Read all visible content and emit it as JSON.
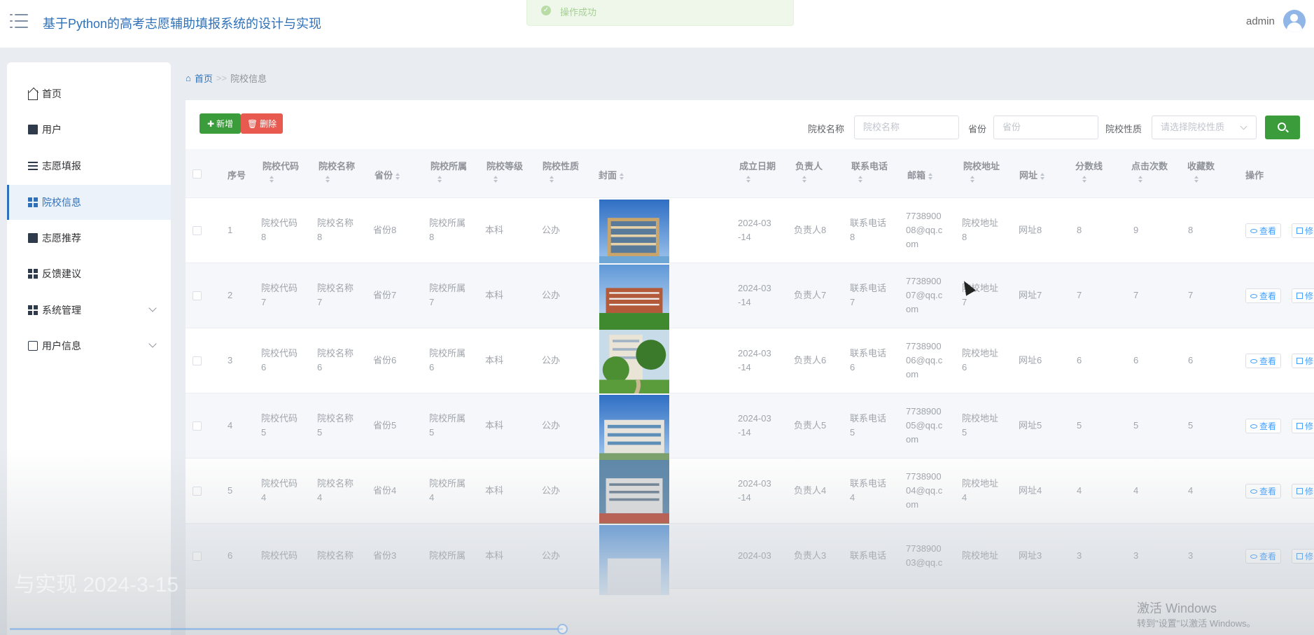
{
  "app": {
    "title": "基于Python的高考志愿辅助填报系统的设计与实现",
    "user": "admin"
  },
  "toast": {
    "text": "操作成功"
  },
  "sidebar": {
    "items": [
      {
        "label": "首页",
        "icon": "home-icon"
      },
      {
        "label": "用户",
        "icon": "book-icon"
      },
      {
        "label": "志愿填报",
        "icon": "list-icon"
      },
      {
        "label": "院校信息",
        "icon": "grid-icon",
        "active": true
      },
      {
        "label": "志愿推荐",
        "icon": "monitor-icon"
      },
      {
        "label": "反馈建议",
        "icon": "grid-icon"
      },
      {
        "label": "系统管理",
        "icon": "grid-icon",
        "expandable": true
      },
      {
        "label": "用户信息",
        "icon": "card-icon",
        "expandable": true
      }
    ]
  },
  "breadcrumb": {
    "home": "首页",
    "sep": ">>",
    "current": "院校信息"
  },
  "toolbar": {
    "add": "新增",
    "delete": "删除"
  },
  "filters": {
    "name_label": "院校名称",
    "name_placeholder": "院校名称",
    "province_label": "省份",
    "province_placeholder": "省份",
    "type_label": "院校性质",
    "type_placeholder": "请选择院校性质"
  },
  "table": {
    "headers": {
      "index": "序号",
      "code": "院校代码",
      "name": "院校名称",
      "province": "省份",
      "affiliation": "院校所属",
      "level": "院校等级",
      "nature": "院校性质",
      "cover": "封面",
      "founded": "成立日期",
      "leader": "负责人",
      "phone": "联系电话",
      "email": "邮箱",
      "address": "院校地址",
      "website": "网址",
      "score": "分数线",
      "clicks": "点击次数",
      "favorites": "收藏数",
      "actions": "操作"
    },
    "view_label": "查看",
    "edit_label": "修",
    "rows": [
      {
        "index": "1",
        "code": [
          "院校代码",
          "8"
        ],
        "name": [
          "院校名称",
          "8"
        ],
        "province": "省份8",
        "affiliation": [
          "院校所属",
          "8"
        ],
        "level": "本科",
        "nature": "公办",
        "founded": [
          "2024-03",
          "-14"
        ],
        "leader": "负责人8",
        "phone": [
          "联系电话",
          "8"
        ],
        "email": [
          "7738900",
          "08@qq.c",
          "om"
        ],
        "address": [
          "院校地址",
          "8"
        ],
        "website": "网址8",
        "score": "8",
        "clicks": "9",
        "favorites": "8"
      },
      {
        "index": "2",
        "code": [
          "院校代码",
          "7"
        ],
        "name": [
          "院校名称",
          "7"
        ],
        "province": "省份7",
        "affiliation": [
          "院校所属",
          "7"
        ],
        "level": "本科",
        "nature": "公办",
        "founded": [
          "2024-03",
          "-14"
        ],
        "leader": "负责人7",
        "phone": [
          "联系电话",
          "7"
        ],
        "email": [
          "7738900",
          "07@qq.c",
          "om"
        ],
        "address": [
          "院校地址",
          "7"
        ],
        "website": "网址7",
        "score": "7",
        "clicks": "7",
        "favorites": "7"
      },
      {
        "index": "3",
        "code": [
          "院校代码",
          "6"
        ],
        "name": [
          "院校名称",
          "6"
        ],
        "province": "省份6",
        "affiliation": [
          "院校所属",
          "6"
        ],
        "level": "本科",
        "nature": "公办",
        "founded": [
          "2024-03",
          "-14"
        ],
        "leader": "负责人6",
        "phone": [
          "联系电话",
          "6"
        ],
        "email": [
          "7738900",
          "06@qq.c",
          "om"
        ],
        "address": [
          "院校地址",
          "6"
        ],
        "website": "网址6",
        "score": "6",
        "clicks": "6",
        "favorites": "6"
      },
      {
        "index": "4",
        "code": [
          "院校代码",
          "5"
        ],
        "name": [
          "院校名称",
          "5"
        ],
        "province": "省份5",
        "affiliation": [
          "院校所属",
          "5"
        ],
        "level": "本科",
        "nature": "公办",
        "founded": [
          "2024-03",
          "-14"
        ],
        "leader": "负责人5",
        "phone": [
          "联系电话",
          "5"
        ],
        "email": [
          "7738900",
          "05@qq.c",
          "om"
        ],
        "address": [
          "院校地址",
          "5"
        ],
        "website": "网址5",
        "score": "5",
        "clicks": "5",
        "favorites": "5"
      },
      {
        "index": "5",
        "code": [
          "院校代码",
          "4"
        ],
        "name": [
          "院校名称",
          "4"
        ],
        "province": "省份4",
        "affiliation": [
          "院校所属",
          "4"
        ],
        "level": "本科",
        "nature": "公办",
        "founded": [
          "2024-03",
          "-14"
        ],
        "leader": "负责人4",
        "phone": [
          "联系电话",
          "4"
        ],
        "email": [
          "7738900",
          "04@qq.c",
          "om"
        ],
        "address": [
          "院校地址",
          "4"
        ],
        "website": "网址4",
        "score": "4",
        "clicks": "4",
        "favorites": "4"
      },
      {
        "index": "6",
        "code": [
          "院校代码"
        ],
        "name": [
          "院校名称"
        ],
        "province": "省份3",
        "affiliation": [
          "院校所属"
        ],
        "level": "本科",
        "nature": "公办",
        "founded": [
          "2024-03"
        ],
        "leader": "负责人3",
        "phone": [
          "联系电话"
        ],
        "email": [
          "7738900",
          "03@qq.c"
        ],
        "address": [
          "院校地址"
        ],
        "website": "网址3",
        "score": "3",
        "clicks": "3",
        "favorites": "3"
      }
    ]
  },
  "watermark": {
    "line1": "激活 Windows",
    "line2": "转到\"设置\"以激活 Windows。"
  },
  "colors": {
    "primary": "#2f71b8",
    "success": "#3a9c3a",
    "danger": "#e85a4f",
    "link": "#409eff"
  }
}
